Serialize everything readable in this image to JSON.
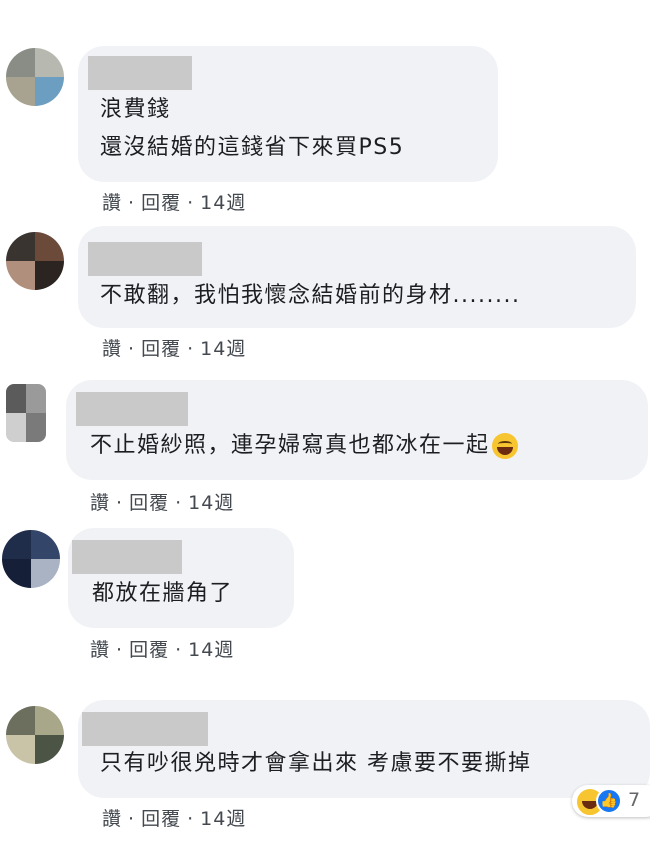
{
  "comments": [
    {
      "text_lines": [
        "浪費錢",
        "還沒結婚的這錢省下來買PS5"
      ],
      "actions": {
        "like": "讚",
        "reply": "回覆",
        "separator": "·",
        "time": "14週"
      },
      "avatar_colors": [
        "#8a8d86",
        "#b7b9b0",
        "#6c9ec2",
        "#a7a390"
      ]
    },
    {
      "text_lines": [
        "不敢翻，我怕我懷念結婚前的身材........"
      ],
      "actions": {
        "like": "讚",
        "reply": "回覆",
        "separator": "·",
        "time": "14週"
      },
      "avatar_colors": [
        "#3a3431",
        "#6b4a3a",
        "#2b2420",
        "#b08f7c"
      ]
    },
    {
      "text_lines": [
        "不止婚紗照，連孕婦寫真也都冰在一起"
      ],
      "has_emoji": true,
      "emoji": "laughing-tears-emoji",
      "actions": {
        "like": "讚",
        "reply": "回覆",
        "separator": "·",
        "time": "14週"
      },
      "avatar_colors": [
        "#5b5b5b",
        "#9a9a9a",
        "#7a7a7a",
        "#cfcfcf"
      ]
    },
    {
      "text_lines": [
        "都放在牆角了"
      ],
      "actions": {
        "like": "讚",
        "reply": "回覆",
        "separator": "·",
        "time": "14週"
      },
      "avatar_colors": [
        "#1f2c4a",
        "#34456a",
        "#a9b3c4",
        "#152038"
      ]
    },
    {
      "text_lines": [
        "只有吵很兇時才會拿出來 考慮要不要撕掉"
      ],
      "actions": {
        "like": "讚",
        "reply": "回覆",
        "separator": "·",
        "time": "14週"
      },
      "avatar_colors": [
        "#6c6e5e",
        "#a9a78a",
        "#4c5545",
        "#c9c4a8"
      ]
    }
  ],
  "reactions": {
    "icons": [
      "haha-reaction-icon",
      "like-reaction-icon"
    ],
    "like_glyph": "👍",
    "count": "7"
  }
}
